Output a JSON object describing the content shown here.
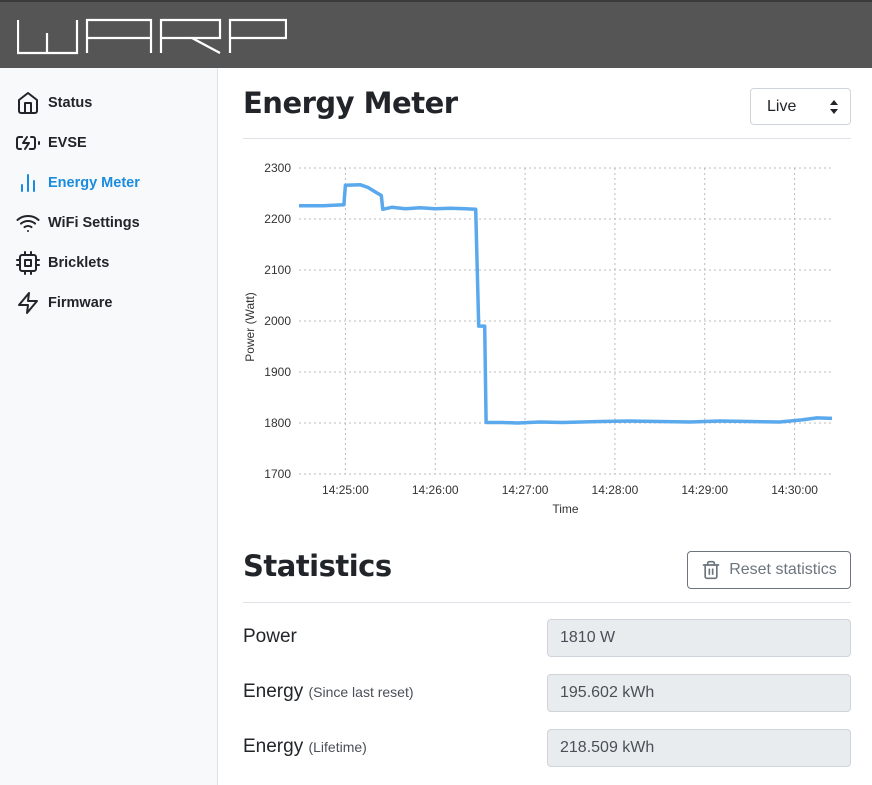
{
  "app": {
    "logo_text": "WARP"
  },
  "sidebar": {
    "items": [
      {
        "label": "Status",
        "icon": "home-icon"
      },
      {
        "label": "EVSE",
        "icon": "battery-charging-icon"
      },
      {
        "label": "Energy Meter",
        "icon": "bar-chart-icon",
        "active": true
      },
      {
        "label": "WiFi Settings",
        "icon": "wifi-icon"
      },
      {
        "label": "Bricklets",
        "icon": "cpu-icon"
      },
      {
        "label": "Firmware",
        "icon": "zap-icon"
      }
    ]
  },
  "main": {
    "title": "Energy Meter",
    "range_select": {
      "value": "Live"
    },
    "statistics": {
      "title": "Statistics",
      "reset_label": "Reset statistics",
      "rows": [
        {
          "label": "Power",
          "sub": "",
          "value": "1810 W"
        },
        {
          "label": "Energy",
          "sub": "(Since last reset)",
          "value": "195.602 kWh"
        },
        {
          "label": "Energy",
          "sub": "(Lifetime)",
          "value": "218.509 kWh"
        }
      ]
    }
  },
  "colors": {
    "accent": "#1a8ce0",
    "series": "#5aa9ec",
    "header": "#555555"
  },
  "chart_data": {
    "type": "line",
    "xlabel": "Time",
    "ylabel": "Power (Watt)",
    "ylim": [
      1700,
      2300
    ],
    "yticks": [
      1700,
      1800,
      1900,
      2000,
      2100,
      2200,
      2300
    ],
    "xticks": [
      "14:25:00",
      "14:26:00",
      "14:27:00",
      "14:28:00",
      "14:29:00",
      "14:30:00"
    ],
    "xlim": [
      "14:24:29",
      "14:30:25"
    ],
    "grid": true,
    "series": [
      {
        "values": [
          [
            "14:24:29",
            2226
          ],
          [
            "14:24:45",
            2226
          ],
          [
            "14:24:59",
            2228
          ],
          [
            "14:25:00",
            2266
          ],
          [
            "14:25:10",
            2267
          ],
          [
            "14:25:15",
            2262
          ],
          [
            "14:25:20",
            2253
          ],
          [
            "14:25:24",
            2246
          ],
          [
            "14:25:25",
            2219
          ],
          [
            "14:25:31",
            2223
          ],
          [
            "14:25:40",
            2220
          ],
          [
            "14:25:50",
            2222
          ],
          [
            "14:26:00",
            2220
          ],
          [
            "14:26:10",
            2221
          ],
          [
            "14:26:20",
            2220
          ],
          [
            "14:26:27",
            2219
          ],
          [
            "14:26:29",
            1990
          ],
          [
            "14:26:33",
            1990
          ],
          [
            "14:26:34",
            1801
          ],
          [
            "14:26:45",
            1801
          ],
          [
            "14:26:55",
            1800
          ],
          [
            "14:27:10",
            1802
          ],
          [
            "14:27:25",
            1801
          ],
          [
            "14:27:50",
            1803
          ],
          [
            "14:28:10",
            1804
          ],
          [
            "14:28:30",
            1803
          ],
          [
            "14:28:50",
            1802
          ],
          [
            "14:29:10",
            1804
          ],
          [
            "14:29:30",
            1803
          ],
          [
            "14:29:50",
            1802
          ],
          [
            "14:30:05",
            1806
          ],
          [
            "14:30:15",
            1810
          ],
          [
            "14:30:25",
            1809
          ]
        ]
      }
    ]
  }
}
